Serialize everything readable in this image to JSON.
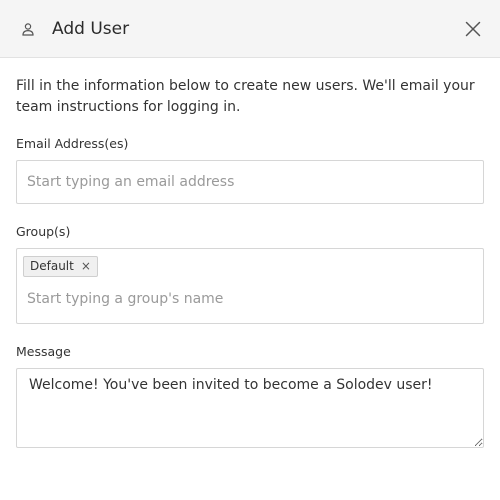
{
  "header": {
    "title": "Add User",
    "icon": "user-icon",
    "close_icon": "close-icon"
  },
  "intro_text": "Fill in the information below to create new users. We'll email your team instructions for logging in.",
  "email": {
    "label": "Email Address(es)",
    "placeholder": "Start typing an email address",
    "value": ""
  },
  "groups": {
    "label": "Group(s)",
    "tags": [
      {
        "label": "Default",
        "remove_symbol": "×"
      }
    ],
    "placeholder": "Start typing a group's name"
  },
  "message": {
    "label": "Message",
    "value": "Welcome! You've been invited to become a Solodev user!"
  },
  "colors": {
    "header_bg": "#f5f5f5",
    "border": "#d6d6d6",
    "placeholder": "#9a9a9a",
    "tag_bg": "#f0f0f0"
  }
}
